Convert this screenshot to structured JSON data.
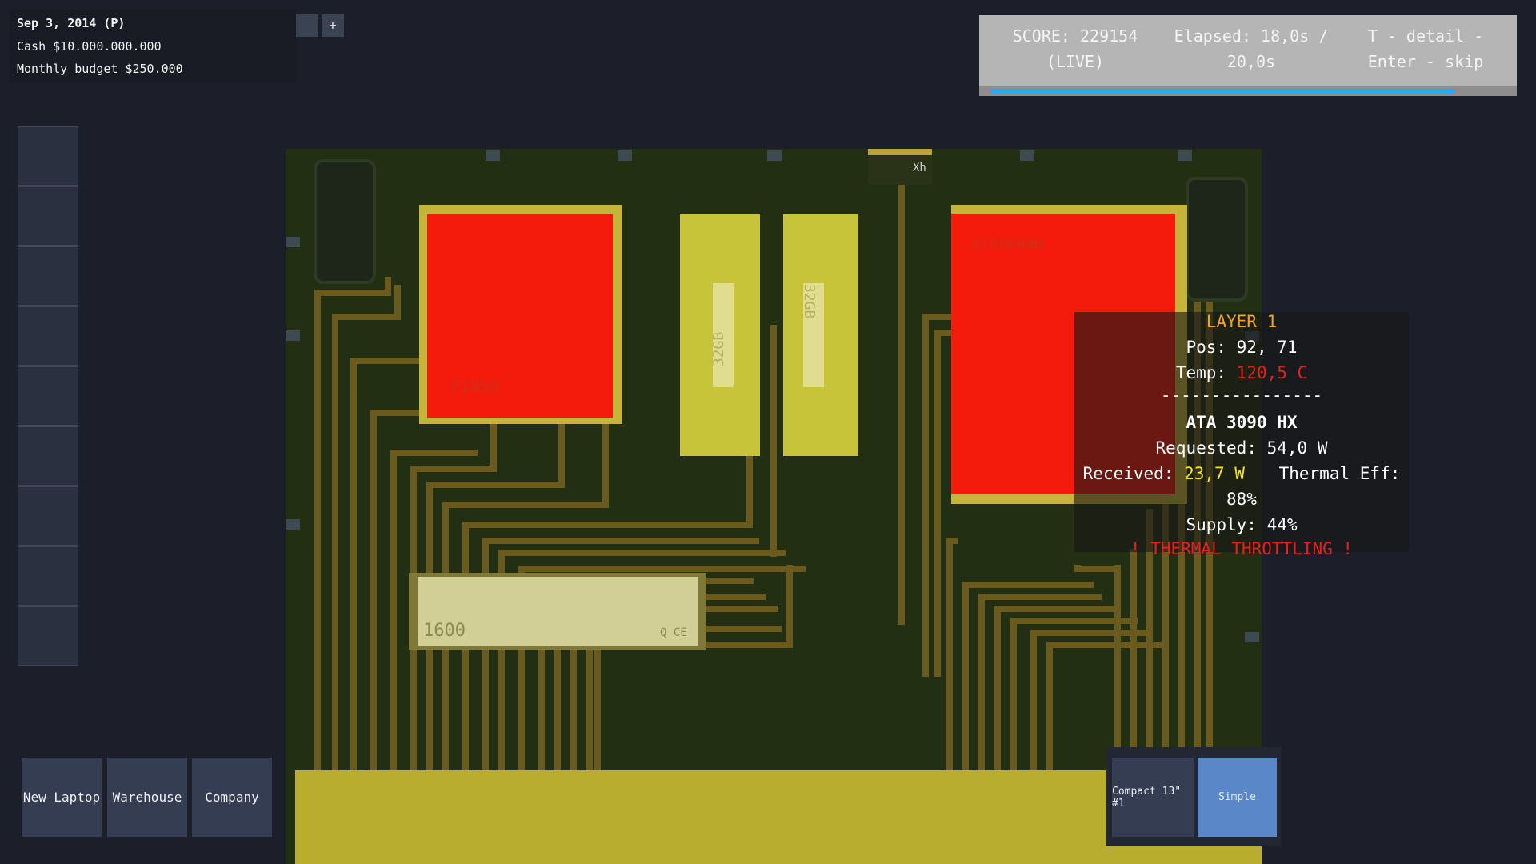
{
  "header": {
    "date": "Sep 3, 2014 (P)",
    "cash": "Cash $10.000.000.000",
    "budget": "Monthly budget $250.000",
    "zoom_in_label": "+"
  },
  "score_panel": {
    "score_line1": "SCORE: 229154",
    "score_line2": "(LIVE)",
    "elapsed_line1": "Elapsed: 18,0s /",
    "elapsed_line2": "20,0s",
    "hint_line1": "T - detail -",
    "hint_line2": "Enter - skip",
    "progress_fraction": 0.9
  },
  "board": {
    "chip_left_label": "F1950",
    "chip_right_label": "ATA3090HX",
    "ram_left_label": "32GB",
    "ram_right_label": "32GB",
    "ssd_label": "1600",
    "ssd_marks": "Q CE",
    "top_connector_label": "Xh"
  },
  "tooltip": {
    "layer": "LAYER 1",
    "pos": "Pos: 92, 71",
    "temp_label": "Temp: ",
    "temp_value": "120,5 C",
    "divider": "----------------",
    "component": "ATA 3090 HX",
    "requested": "Requested: 54,0 W",
    "received_label": "Received: ",
    "received_value": "23,7 W",
    "thermal_label": "Thermal Eff:",
    "thermal_value": "88%",
    "supply": "Supply: 44%",
    "warning": "! THERMAL THROTTLING !"
  },
  "nav": {
    "new_laptop": "New Laptop",
    "warehouse": "Warehouse",
    "company": "Company"
  },
  "layouts": {
    "compact": "Compact 13\" #1",
    "simple": "Simple"
  },
  "colors": {
    "board": "#222f12",
    "trace": "#6b5a1e",
    "chip_hot": "#f41a0c",
    "chip_frame": "#c6b43a",
    "ram": "#c8c43a",
    "progress": "#29a9e8",
    "warning": "#e82018",
    "highlight_yellow": "#f4e21a",
    "layer_title": "#f2a41c"
  }
}
